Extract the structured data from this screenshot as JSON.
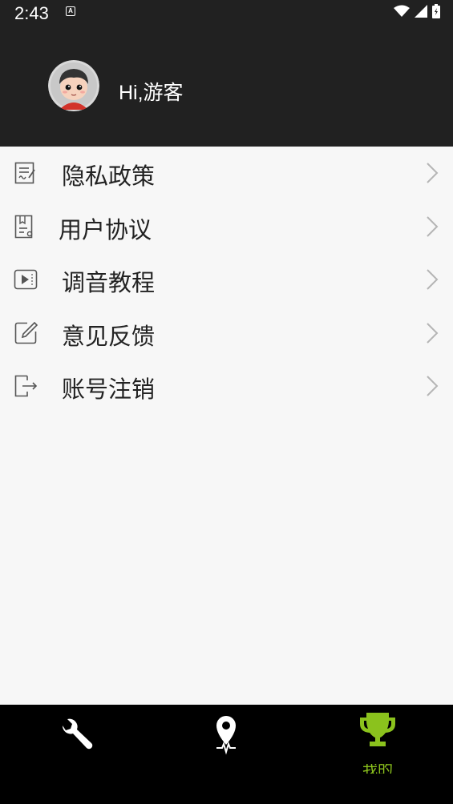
{
  "status_bar": {
    "time": "2:43",
    "notification_badge": "A",
    "icons": [
      "wifi-icon",
      "signal-icon",
      "battery-icon"
    ]
  },
  "profile": {
    "greeting": "Hi,游客",
    "avatar": "cartoon-boy-avatar"
  },
  "menu": {
    "items": [
      {
        "label": "隐私政策",
        "icon": "document-edit-icon"
      },
      {
        "label": "用户协议",
        "icon": "agreement-icon"
      },
      {
        "label": "调音教程",
        "icon": "video-play-icon"
      },
      {
        "label": "意见反馈",
        "icon": "edit-pencil-icon"
      },
      {
        "label": "账号注销",
        "icon": "logout-icon"
      }
    ]
  },
  "bottom_nav": {
    "tabs": [
      {
        "label": "",
        "icon": "wrench-icon",
        "active": false
      },
      {
        "label": "",
        "icon": "location-pulse-icon",
        "active": false
      },
      {
        "label": "我的",
        "icon": "trophy-icon",
        "active": true
      }
    ],
    "active_color": "#8bc21d"
  },
  "colors": {
    "header_bg": "#212121",
    "page_bg": "#f7f7f7",
    "nav_bg": "#000000",
    "accent": "#8bc21d"
  }
}
